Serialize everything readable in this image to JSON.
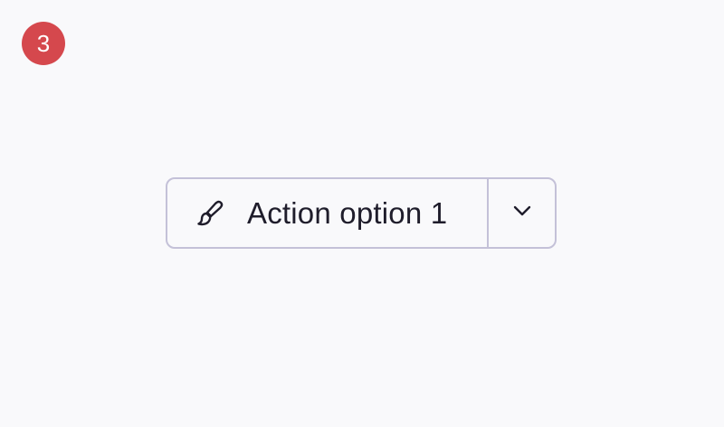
{
  "step_badge": {
    "label": "3",
    "color": "#d5484d"
  },
  "split_button": {
    "icon": "paintbrush-icon",
    "label": "Action option 1",
    "dropdown_icon": "chevron-down-icon",
    "border_color": "#c4c1d8",
    "text_color": "#1f1d2b"
  }
}
